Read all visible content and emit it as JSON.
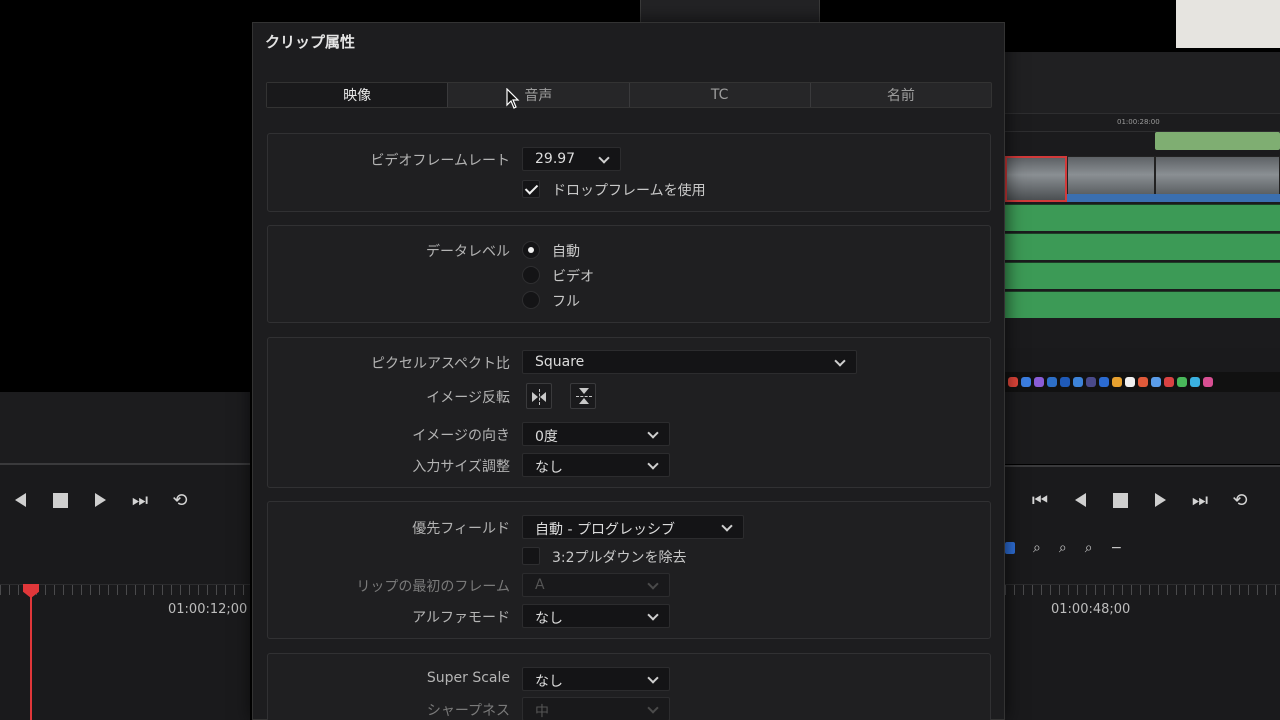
{
  "dialog": {
    "title": "クリップ属性",
    "tabs": [
      {
        "label": "映像",
        "active": true
      },
      {
        "label": "音声",
        "active": false
      },
      {
        "label": "TC",
        "active": false
      },
      {
        "label": "名前",
        "active": false
      }
    ]
  },
  "frame_rate": {
    "label": "ビデオフレームレート",
    "value": "29.97",
    "drop_frame_label": "ドロップフレームを使用",
    "drop_frame_checked": true
  },
  "data_level": {
    "label": "データレベル",
    "options": [
      "自動",
      "ビデオ",
      "フル"
    ],
    "selected": "自動"
  },
  "image": {
    "pixel_aspect_label": "ピクセルアスペクト比",
    "pixel_aspect_value": "Square",
    "flip_label": "イメージ反転",
    "orientation_label": "イメージの向き",
    "orientation_value": "0度",
    "input_size_label": "入力サイズ調整",
    "input_size_value": "なし"
  },
  "field": {
    "priority_label": "優先フィールド",
    "priority_value": "自動 - プログレッシブ",
    "pulldown_label": "3:2プルダウンを除去",
    "pulldown_checked": false,
    "first_frame_label": "リップの最初のフレーム",
    "first_frame_value": "A",
    "alpha_label": "アルファモード",
    "alpha_value": "なし"
  },
  "scale": {
    "super_scale_label": "Super Scale",
    "super_scale_value": "なし",
    "sharpness_label": "シャープネス",
    "sharpness_value": "中"
  },
  "background": {
    "left_timecode": "01:00:12;00",
    "right_timecode": "01:00:48;00",
    "timeline_ruler": "01:00:28:00"
  },
  "colors": {
    "playhead": "#e0373a",
    "audio_clip": "#3c9a56",
    "video_clip_bar": "#3b6fb0"
  }
}
